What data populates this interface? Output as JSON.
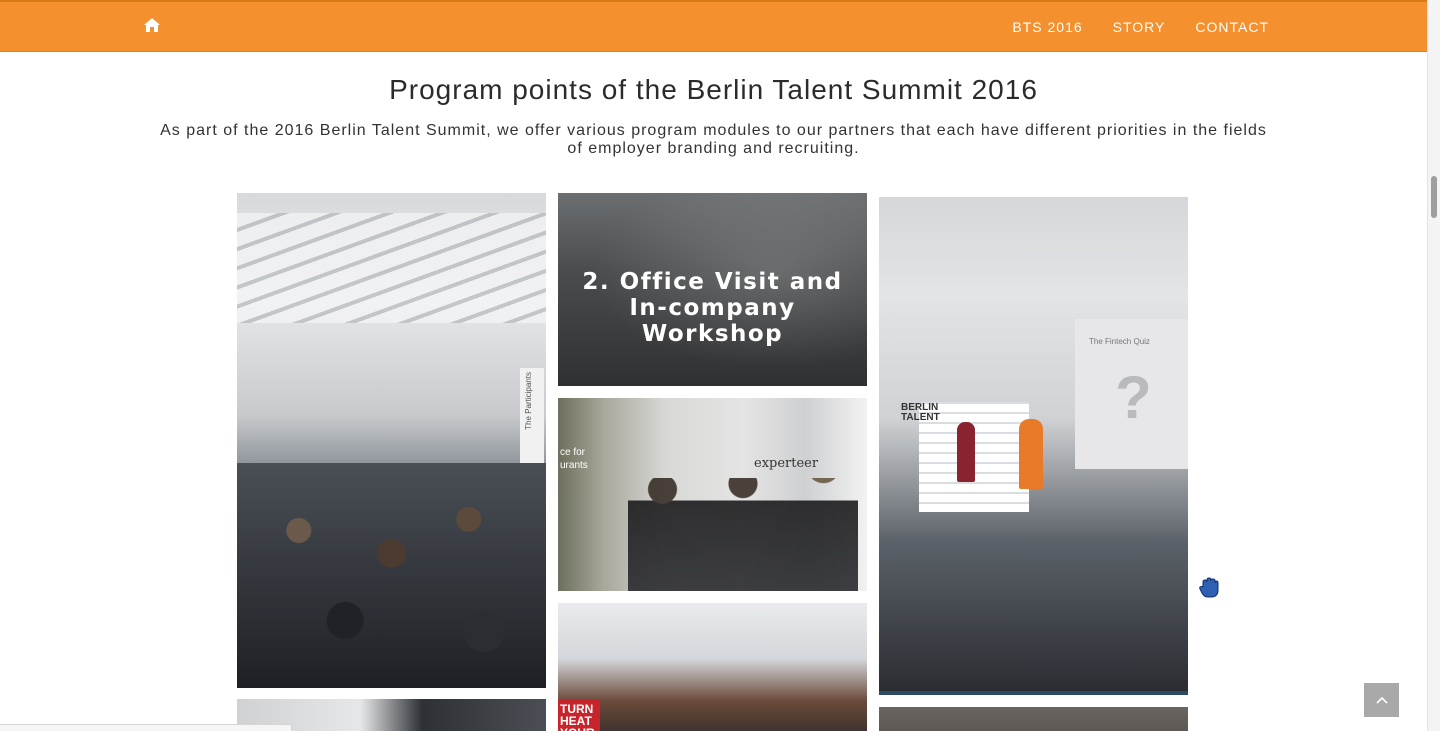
{
  "nav": {
    "home_icon": "home-icon",
    "links": [
      "BTS 2016",
      "STORY",
      "CONTACT"
    ]
  },
  "main": {
    "title": "Program points of the Berlin Talent Summit 2016",
    "intro": "As part of the 2016 Berlin Talent Summit, we offer various program modules to our partners that each have different priorities in the fields of employer branding and recruiting."
  },
  "gallery": {
    "tiles": [
      {
        "caption_line1": "2. Office Visit and",
        "caption_line2": "In-company Workshop"
      }
    ],
    "photo_text": {
      "participants_banner": "The Participants",
      "experteer": "experteer",
      "restaurants": "ce for\nurants",
      "turn_heat": "TURN\nHEAT\nYOUR",
      "fintech_quiz": "The Fintech Quiz",
      "berlin_talent": "BERLIN\nTALENT"
    }
  },
  "colors": {
    "accent": "#f4902d",
    "nav_text": "#ffffff",
    "back_to_top": "#a9a9a9"
  },
  "icons": {
    "drag": "hand-grab-icon",
    "back_to_top": "chevron-up-icon"
  }
}
